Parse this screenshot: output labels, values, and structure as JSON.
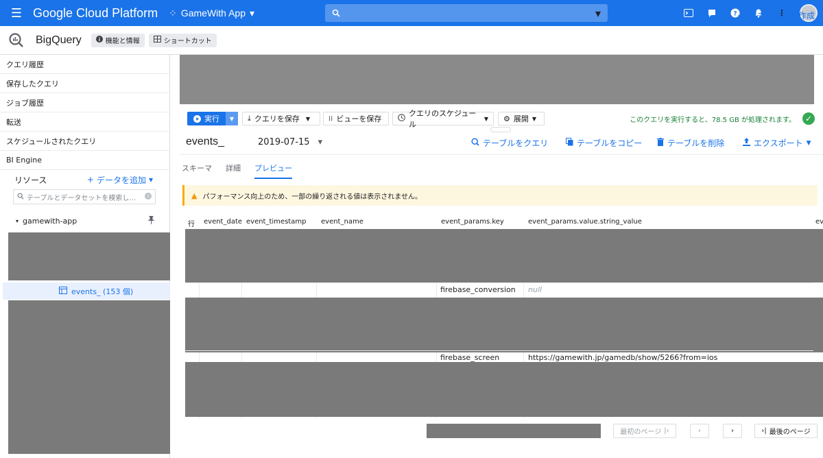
{
  "topbar": {
    "app_title": "Google Cloud Platform",
    "project_name": "GameWith App"
  },
  "subbar": {
    "product": "BigQuery",
    "chip_features": "機能と情報",
    "chip_shortcuts": "ショートカット",
    "new_query": "クエリを新規作成"
  },
  "sidebar": {
    "items": [
      {
        "label": "クエリ履歴"
      },
      {
        "label": "保存したクエリ"
      },
      {
        "label": "ジョブ履歴"
      },
      {
        "label": "転送"
      },
      {
        "label": "スケジュールされたクエリ"
      },
      {
        "label": "BI Engine"
      }
    ],
    "resources_label": "リソース",
    "add_data": "データを追加",
    "search_placeholder": "テーブルとデータセットを検索し...",
    "project_node": "gamewith-app",
    "selected_table": "events_ (153 個)"
  },
  "toolbar": {
    "run": "実行",
    "save_query": "クエリを保存",
    "save_view": "ビューを保存",
    "schedule": "クエリのスケジュール",
    "expand": "展開",
    "estimate": "このクエリを実行すると、78.5 GB が処理されます。"
  },
  "table": {
    "name": "events_",
    "date": "2019-07-15",
    "actions": {
      "query_table": "テーブルをクエリ",
      "copy_table": "テーブルをコピー",
      "delete_table": "テーブルを削除",
      "export": "エクスポート"
    },
    "tabs": [
      "スキーマ",
      "詳細",
      "プレビュー"
    ],
    "warning": "パフォーマンス向上のため、一部の繰り返される値は表示されません。",
    "columns": [
      "行",
      "event_date",
      "event_timestamp",
      "event_name",
      "event_params.key",
      "event_params.value.string_value",
      "ev"
    ],
    "rows": [
      {
        "key": "firebase_conversion",
        "value": "null"
      },
      {
        "key": "firebase_screen",
        "value": "https://gamewith.jp/gamedb/show/5266?from=ios"
      }
    ]
  },
  "pager": {
    "first_page": "最初のページ",
    "last_page": "最後のページ"
  },
  "colors": {
    "brand_blue": "#1a73e8",
    "estimate_green": "#188038",
    "redaction_gray": "#7a7a7a"
  }
}
